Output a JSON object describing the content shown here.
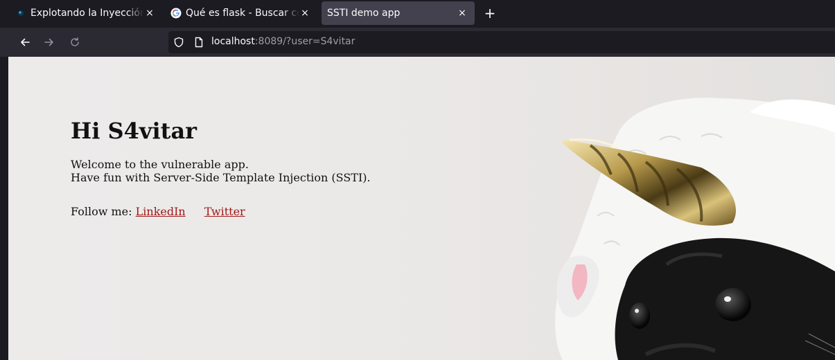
{
  "browser": {
    "tabs": [
      {
        "title": "Explotando la Inyección de",
        "active": false,
        "favicon": "site-icon"
      },
      {
        "title": "Qué es flask - Buscar con Google",
        "active": false,
        "favicon": "google-icon"
      },
      {
        "title": "SSTI demo app",
        "active": true,
        "favicon": "none"
      }
    ],
    "close_glyph": "×",
    "newtab_glyph": "+",
    "url": {
      "host": "localhost",
      "rest": ":8089/?user=S4vitar"
    }
  },
  "page": {
    "heading": "Hi S4vitar",
    "intro_line1": "Welcome to the vulnerable app.",
    "intro_line2": "Have fun with Server-Side Template Injection (SSTI).",
    "follow_label": "Follow me:",
    "links": {
      "linkedin": "LinkedIn",
      "twitter": "Twitter"
    },
    "link_color": "#a01818",
    "image": "unicorn-pug-photo"
  }
}
